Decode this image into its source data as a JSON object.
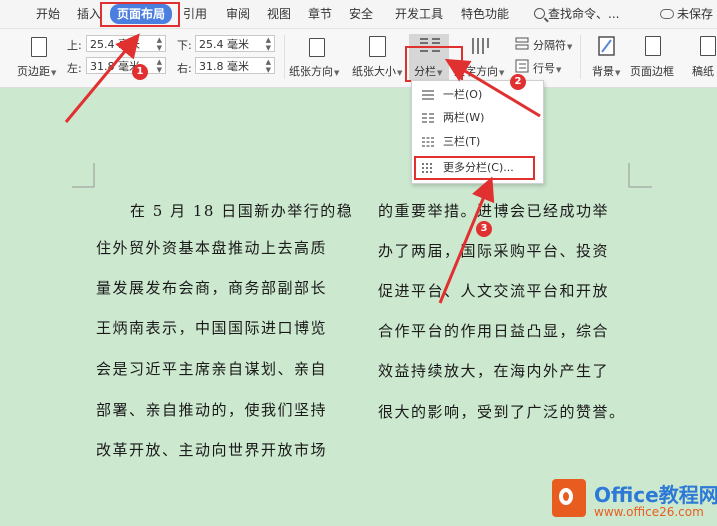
{
  "menu_tabs": [
    "开始",
    "插入",
    "页面布局",
    "引用",
    "审阅",
    "视图",
    "章节",
    "安全",
    "开发工具",
    "特色功能"
  ],
  "search": "查找命令、...",
  "save_status": "未保存",
  "ribbon": {
    "margins_label": "页边距",
    "top_label": "上:",
    "top_value": "25.4 毫米",
    "bottom_label": "下:",
    "bottom_value": "25.4 毫米",
    "left_label": "左:",
    "left_value": "31.8 毫米",
    "right_label": "右:",
    "right_value": "31.8 毫米",
    "orientation": "纸张方向",
    "size": "纸张大小",
    "columns": "分栏",
    "text_direction": "文字方向",
    "break": "分隔符",
    "line_numbers": "行号",
    "background": "背景",
    "page_border": "页面边框",
    "paper": "稿纸"
  },
  "dropdown": {
    "items": [
      "一栏(O)",
      "两栏(W)",
      "三栏(T)",
      "更多分栏(C)..."
    ]
  },
  "document": {
    "left_column": [
      "在 5 月 18 日国新办举行的稳",
      "住外贸外资基本盘推动上去高质",
      "量发展发布会商，商务部副部长",
      "王炳南表示，中国国际进口博览",
      "会是习近平主席亲自谋划、亲自",
      "部署、亲自推动的，使我们坚持",
      "改革开放、主动向世界开放市场"
    ],
    "right_column": [
      "的重要举措。进博会已经成功举",
      "办了两届，国际采购平台、投资",
      "促进平台、人文交流平台和开放",
      "合作平台的作用日益凸显，综合",
      "效益持续放大，在海内外产生了",
      "很大的影响，受到了广泛的赞誉。"
    ]
  },
  "badges": [
    "1",
    "2",
    "3"
  ],
  "logo": {
    "main": "Office教程网",
    "sub": "www.office26.com"
  },
  "colors": {
    "page_bg": "#cce8cf",
    "active_tab": "#4a7fe0",
    "annotation_red": "#e03030",
    "logo_orange": "#e85d1f",
    "logo_blue": "#2c7ad6"
  }
}
